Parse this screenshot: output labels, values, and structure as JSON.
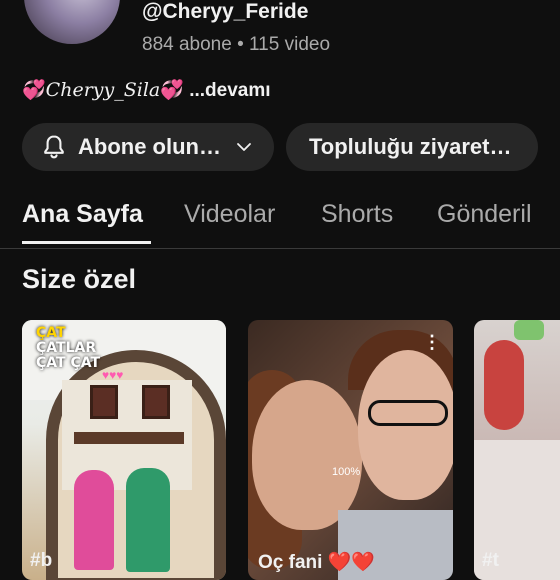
{
  "channel": {
    "handle": "@Cheryy_Feride",
    "stats": "884 abone • 115 video",
    "description": {
      "heart_left": "💞",
      "name": "Cheryy_Sila",
      "heart_right": "💞",
      "more": " ...devamı"
    }
  },
  "actions": {
    "subscribe_label": "Abone olun…",
    "community_label": "Topluluğu ziyaret…"
  },
  "tabs": [
    {
      "label": "Ana Sayfa",
      "active": true
    },
    {
      "label": "Videolar",
      "active": false
    },
    {
      "label": "Shorts",
      "active": false
    },
    {
      "label": "Gönderil",
      "active": false
    }
  ],
  "section_title": "Size özel",
  "shorts": [
    {
      "overlay_line1": "ÇAT",
      "overlay_line2": "ÇATLAR",
      "overlay_line3": "ÇAT ÇAT",
      "caption": "#b"
    },
    {
      "battery": "100%",
      "menu": "⋮",
      "caption": "Oç fani ❤️❤️"
    },
    {
      "caption": "#t"
    }
  ],
  "colors": {
    "background": "#0f0f0f",
    "chip": "#272727",
    "text": "#f1f1f1",
    "muted": "#aaaaaa"
  }
}
